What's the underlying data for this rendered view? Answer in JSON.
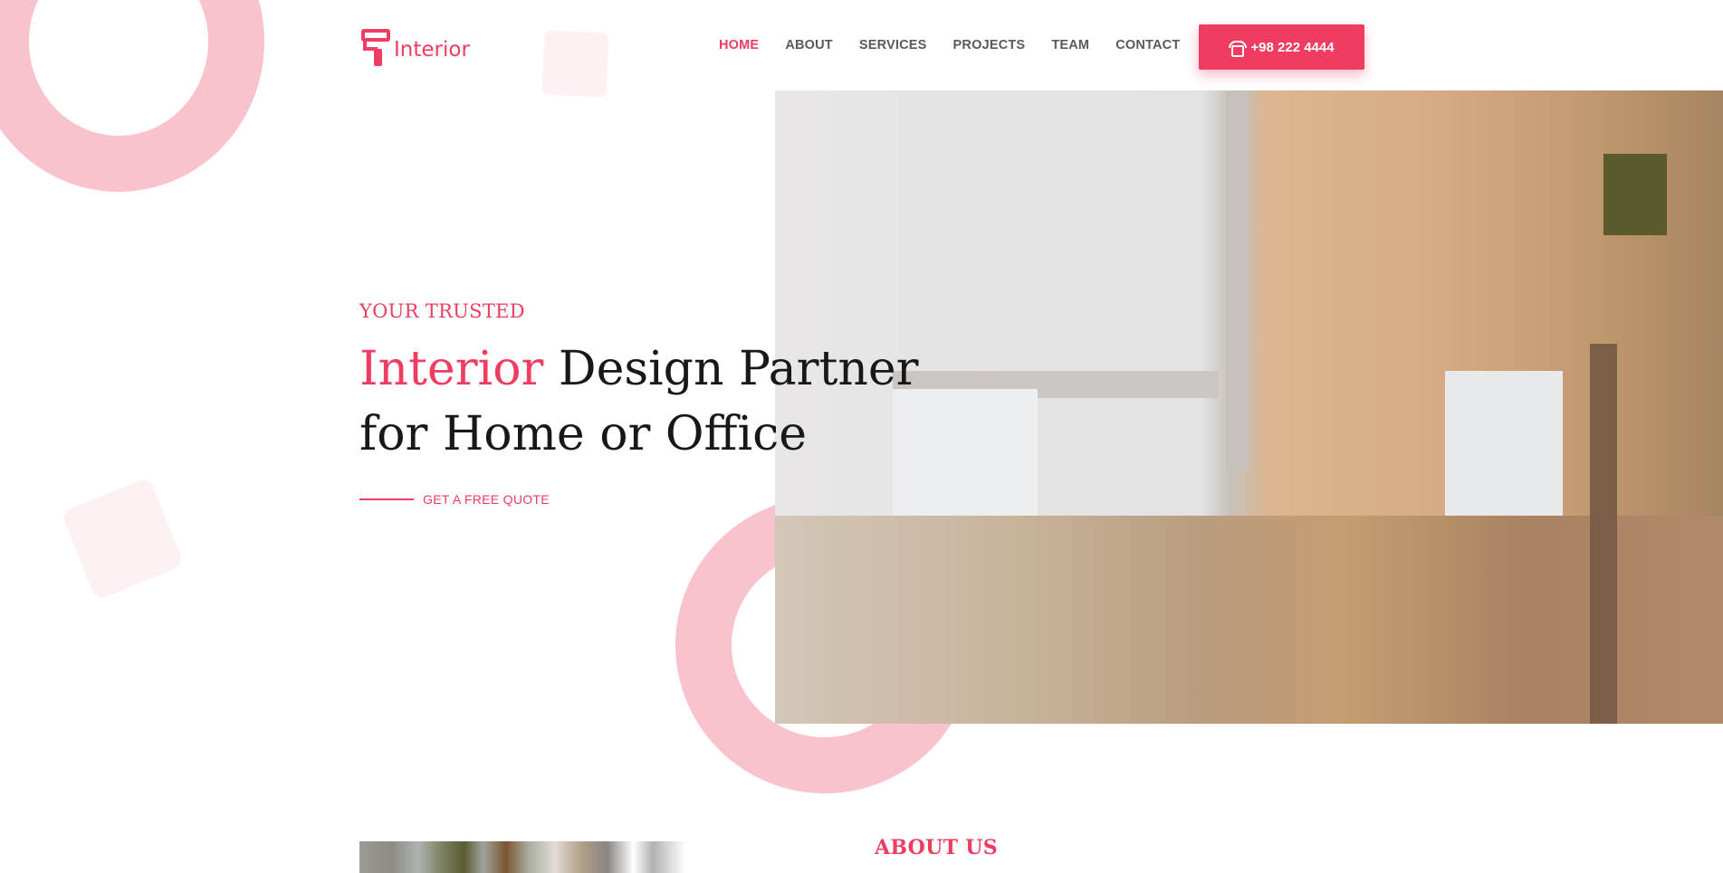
{
  "brand": {
    "name": "Interior",
    "accent_color": "#ef3c60",
    "icon": "paint-roller-icon"
  },
  "nav": {
    "items": [
      {
        "label": "HOME",
        "active": true
      },
      {
        "label": "ABOUT",
        "active": false
      },
      {
        "label": "SERVICES",
        "active": false
      },
      {
        "label": "PROJECTS",
        "active": false
      },
      {
        "label": "TEAM",
        "active": false
      },
      {
        "label": "CONTACT",
        "active": false
      }
    ]
  },
  "contact_button": {
    "icon": "phone-icon",
    "label": "+98 222 4444"
  },
  "hero": {
    "eyebrow": "YOUR TRUSTED",
    "title_accent": "Interior",
    "title_rest_line1": "Design Partner",
    "title_line2": "for Home or Office",
    "cta_label": "GET A FREE QUOTE"
  },
  "about": {
    "title": "ABOUT US"
  }
}
